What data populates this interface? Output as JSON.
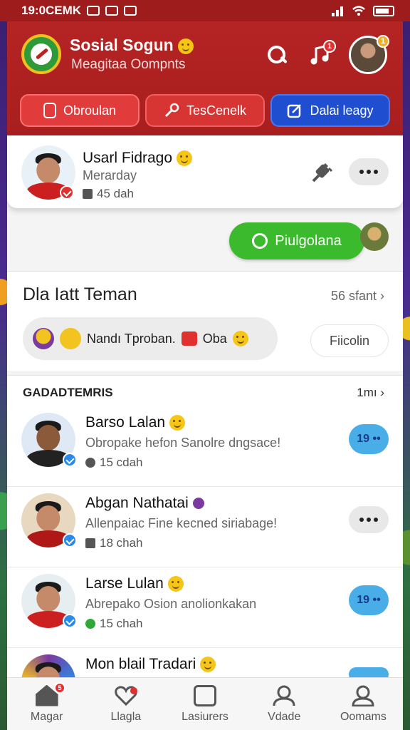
{
  "status_bar": {
    "time": "19:0CEMK"
  },
  "header": {
    "title": "Sosial Sogun",
    "subtitle": "Meagitaa Oompnts",
    "music_badge": "1",
    "avatar_badge": "1"
  },
  "tabs": [
    {
      "label": "Obroulan",
      "color": "#e23b3b"
    },
    {
      "label": "TesCenelk",
      "color": "#d73434"
    },
    {
      "label": "Dalai leagy",
      "color": "#1f4fd0"
    }
  ],
  "profile_card": {
    "name": "Usarl Fidrago",
    "sub": "Merarday",
    "meta": "45 dah"
  },
  "green_button": {
    "label": "Piulgolana",
    "color": "#3cba2e"
  },
  "friends_section": {
    "title": "Dla Iatt Teman",
    "link": "56 sfant",
    "strip_text_1": "Nandı Tproban.",
    "strip_text_2": "Oba",
    "action": "Fiicolin"
  },
  "list_section": {
    "title": "GADADTEMRIS",
    "link": "1mı",
    "items": [
      {
        "name": "Barso Lalan",
        "message": "Obropake hefon Sanolre dngsace!",
        "meta": "15 cdah",
        "action": "19 ••"
      },
      {
        "name": "Abgan Nathatai",
        "message": "Allenpaiac Fine kecned siriabage!",
        "meta": "18 chah",
        "action": "•••"
      },
      {
        "name": "Larse Lulan",
        "message": "Abrepako Osion anolionkakan",
        "meta": "15 chah",
        "action": "19 ••"
      },
      {
        "name": "Mon blail Tradari",
        "message": "",
        "meta": "",
        "action": ""
      }
    ]
  },
  "bottom_nav": [
    {
      "label": "Magar",
      "icon": "home-icon",
      "badge": "5"
    },
    {
      "label": "Llagla",
      "icon": "heart-icon"
    },
    {
      "label": "Lasiurers",
      "icon": "image-icon"
    },
    {
      "label": "Vdade",
      "icon": "person-icon"
    },
    {
      "label": "Oomams",
      "icon": "profile-icon"
    }
  ]
}
